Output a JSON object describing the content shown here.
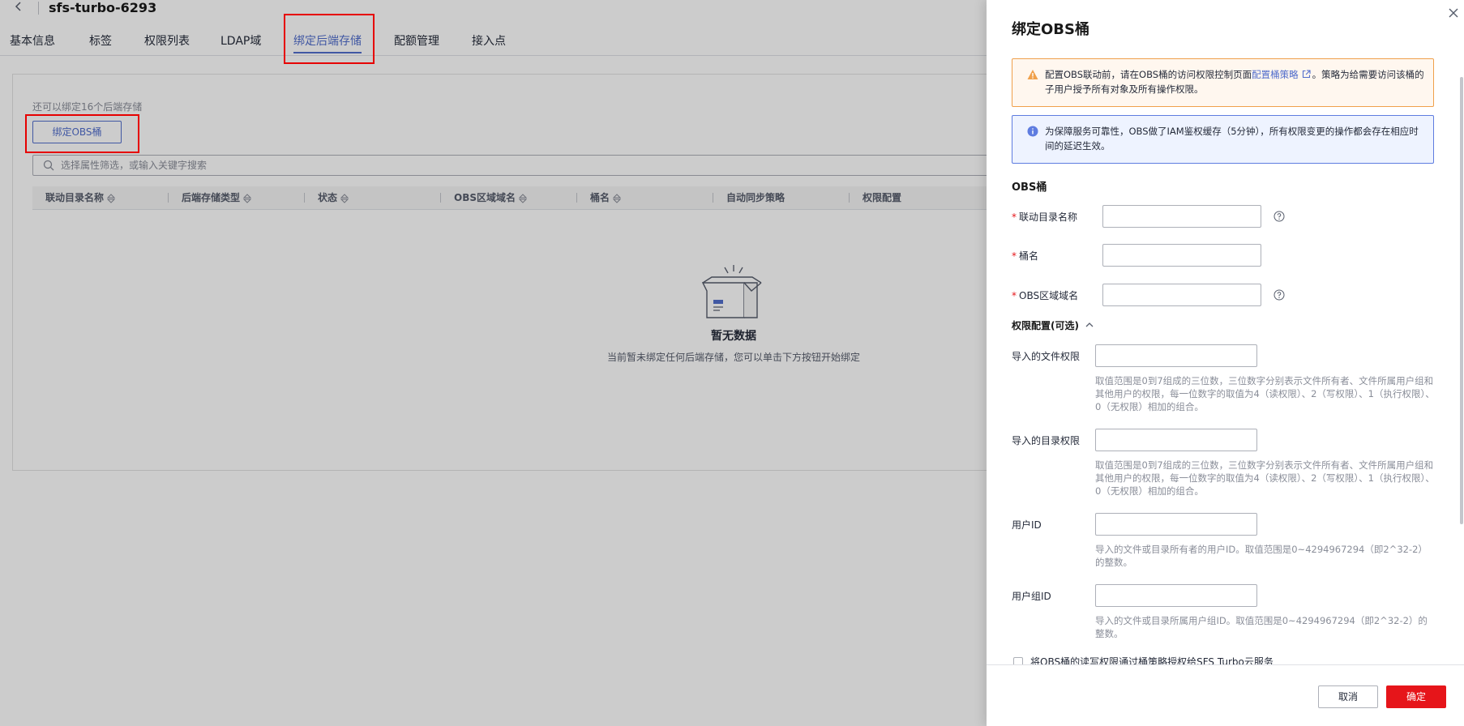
{
  "header": {
    "back_icon": "chevron-left-icon",
    "title": "sfs-turbo-6293"
  },
  "tabs": [
    {
      "label": "基本信息"
    },
    {
      "label": "标签"
    },
    {
      "label": "权限列表"
    },
    {
      "label": "LDAP域"
    },
    {
      "label": "绑定后端存储",
      "active": true
    },
    {
      "label": "配额管理"
    },
    {
      "label": "接入点"
    }
  ],
  "main": {
    "quota_hint": "还可以绑定16个后端存储",
    "bind_button": "绑定OBS桶",
    "search_placeholder": "选择属性筛选，或输入关键字搜索",
    "table_columns": [
      {
        "label": "联动目录名称",
        "sortable": true
      },
      {
        "label": "后端存储类型",
        "sortable": true
      },
      {
        "label": "状态",
        "sortable": true
      },
      {
        "label": "OBS区域域名",
        "sortable": true
      },
      {
        "label": "桶名",
        "sortable": true
      },
      {
        "label": "自动同步策略",
        "sortable": false
      },
      {
        "label": "权限配置",
        "sortable": false
      }
    ],
    "empty_title": "暂无数据",
    "empty_desc": "当前暂未绑定任何后端存储，您可以单击下方按钮开始绑定"
  },
  "drawer": {
    "title": "绑定OBS桶",
    "warning": {
      "before_link": "配置OBS联动前，请在OBS桶的访问权限控制页面",
      "link": "配置桶策略",
      "after_link": "。策略为给需要访问该桶的子用户授予所有对象及所有操作权限。"
    },
    "info": "为保障服务可靠性，OBS做了IAM鉴权缓存（5分钟），所有权限变更的操作都会存在相应时间的延迟生效。",
    "section_title": "OBS桶",
    "required_mark": "*",
    "fields": {
      "link_dir": {
        "label": "联动目录名称",
        "value": ""
      },
      "bucket": {
        "label": "桶名",
        "value": ""
      },
      "region_domain": {
        "label": "OBS区域域名",
        "value": ""
      }
    },
    "permission_section": "权限配置(可选)",
    "perm_fields": {
      "file_perm": {
        "label": "导入的文件权限",
        "value": "",
        "hint": "取值范围是0到7组成的三位数，三位数字分别表示文件所有者、文件所属用户组和其他用户的权限，每一位数字的取值为4（读权限）、2（写权限）、1（执行权限）、0（无权限）相加的组合。"
      },
      "dir_perm": {
        "label": "导入的目录权限",
        "value": "",
        "hint": "取值范围是0到7组成的三位数，三位数字分别表示文件所有者、文件所属用户组和其他用户的权限，每一位数字的取值为4（读权限）、2（写权限）、1（执行权限）、0（无权限）相加的组合。"
      },
      "uid": {
        "label": "用户ID",
        "value": "",
        "hint": "导入的文件或目录所有者的用户ID。取值范围是0~4294967294（即2^32-2）的整数。"
      },
      "gid": {
        "label": "用户组ID",
        "value": "",
        "hint": "导入的文件或目录所属用户组ID。取值范围是0~4294967294（即2^32-2）的整数。"
      }
    },
    "checkbox_label": "将OBS桶的读写权限通过桶策略授权给SFS Turbo云服务",
    "cancel": "取消",
    "confirm": "确定"
  },
  "colors": {
    "accent": "#526ecc",
    "danger": "#e6151a",
    "warning_border": "#f0a04b",
    "info_border": "#5e7ce0",
    "highlight": "#e60000"
  }
}
